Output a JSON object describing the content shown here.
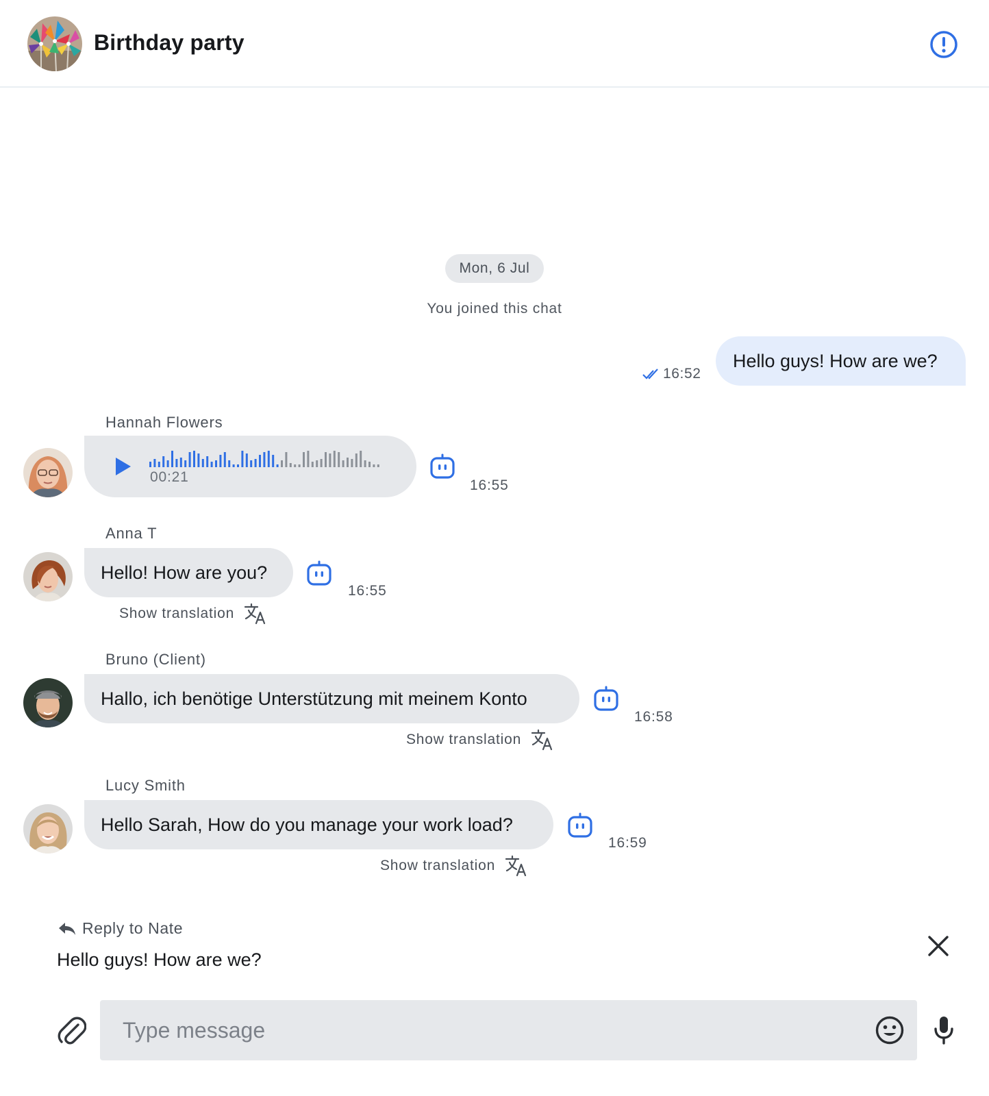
{
  "header": {
    "title": "Birthday party",
    "avatar_icon": "pinwheels-group-avatar",
    "info_icon": "alert-circle-icon",
    "accent_color": "#2f6fe4"
  },
  "conversation": {
    "date_separator": "Mon, 6 Jul",
    "system_note": "You joined this chat",
    "outgoing": {
      "text": "Hello guys! How are we?",
      "time": "16:52",
      "status_icon": "double-check-icon"
    },
    "messages": [
      {
        "sender": "Hannah Flowers",
        "type": "voice",
        "duration": "00:21",
        "time": "16:55",
        "played_fraction": 0.55
      },
      {
        "sender": "Anna T",
        "text": "Hello! How are you?",
        "time": "16:55",
        "translate_label": "Show translation"
      },
      {
        "sender": "Bruno (Client)",
        "text": "Hallo, ich benötige Unterstützung mit meinem Konto",
        "time": "16:58",
        "translate_label": "Show translation"
      },
      {
        "sender": "Lucy Smith",
        "text": "Hello Sarah, How do you manage your work load?",
        "time": "16:59",
        "translate_label": "Show translation"
      }
    ]
  },
  "reply": {
    "label": "Reply to Nate",
    "quoted_text": "Hello guys! How are we?"
  },
  "composer": {
    "placeholder": "Type message",
    "value": ""
  },
  "colors": {
    "accent": "#2f6fe4",
    "incoming_bubble": "#e6e8eb",
    "outgoing_bubble": "#e4edfc"
  }
}
